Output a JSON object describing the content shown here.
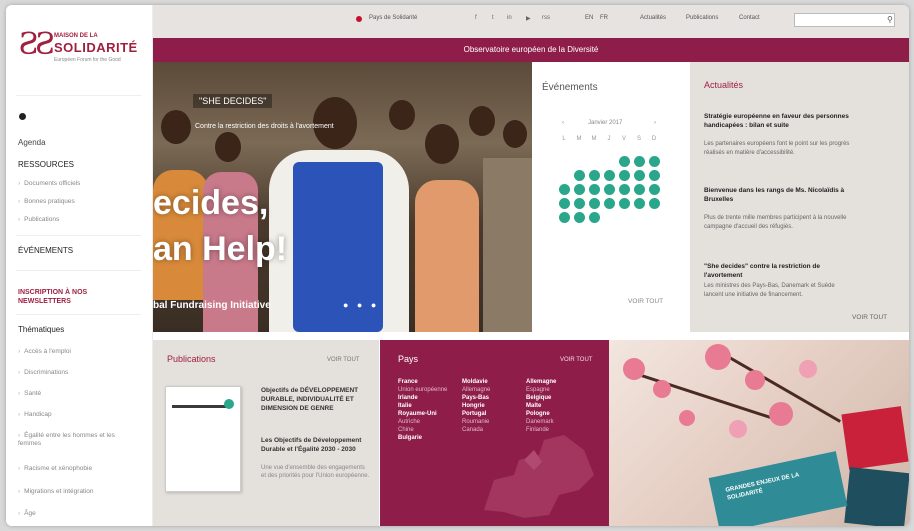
{
  "brand": {
    "mark": "ƧƧ",
    "line1": "MAISON DE LA",
    "line2": "SOLIDARITÉ",
    "line3": "Européen Forum for the Good"
  },
  "topbar": {
    "country_link": "Pays de Solidarité",
    "social": [
      "f",
      "t",
      "in",
      "▶",
      "rss"
    ],
    "langs": [
      "EN",
      "FR"
    ],
    "links": [
      "Actualités",
      "Publications",
      "Contact"
    ],
    "search_placeholder": ""
  },
  "banner": {
    "title": "Observatoire européen de la Diversité"
  },
  "sidebar": {
    "home": "⌂",
    "agenda": "Agenda",
    "resources": "RESSOURCES",
    "resource_items": [
      "Documents officiels",
      "Bonnes pratiques",
      "Publications"
    ],
    "events": "ÉVÉNEMENTS",
    "newsletter": "INSCRIPTION À NOS NEWSLETTERS",
    "themes": "Thématiques",
    "theme_items": [
      "Accès à l'emploi",
      "Discriminations",
      "Santé",
      "Handicap",
      "Égalité entre les hommes et les femmes",
      "Racisme et xénophobie",
      "Migrations et intégration",
      "Âge"
    ]
  },
  "hero": {
    "tag": "\"SHE DECIDES\"",
    "subtitle": "Contre la restriction des droits à l'avortement",
    "line1": "ecides,",
    "line2": "an Help!",
    "caption": "bal Fundraising Initiative",
    "dots": "● ● ●"
  },
  "events": {
    "title": "Événements",
    "month": "Janvier 2017",
    "prev": "‹",
    "next": "›",
    "dow": [
      "L",
      "M",
      "M",
      "J",
      "V",
      "S",
      "D"
    ],
    "more": "VOIR TOUT"
  },
  "news": {
    "title": "Actualités",
    "items": [
      {
        "headline": "Stratégie européenne en faveur des personnes handicapées : bilan et suite",
        "text": "Les partenaires européens font le point sur les progrès réalisés en matière d'accessibilité."
      },
      {
        "headline": "Bienvenue dans les rangs de Ms. Nicolaïdis à Bruxelles",
        "text": "Plus de trente mille membres participent à la nouvelle campagne d'accueil des réfugiés."
      },
      {
        "headline": "\"She decides\" contre la restriction de l'avortement",
        "text": "Les ministres des Pays-Bas, Danemark et Suède lancent une initiative de financement."
      }
    ],
    "more": "VOIR TOUT"
  },
  "publications": {
    "title": "Publications",
    "more": "VOIR TOUT",
    "items": [
      {
        "title": "Objectifs de DÉVELOPPEMENT DURABLE, INDIVIDUALITÉ ET DIMENSION DE GENRE",
        "text": ""
      },
      {
        "title": "Les Objectifs de Développement Durable et l'Égalité 2030 - 2030",
        "text": "Une vue d'ensemble des engagements et des priorités pour l'Union européenne."
      }
    ]
  },
  "pays": {
    "title": "Pays",
    "more": "VOIR TOUT",
    "col1": [
      "France",
      "Union européenne",
      "Irlande",
      "Italie",
      "Royaume-Uni",
      "Autriche",
      "Chine",
      "Bulgarie"
    ],
    "col2": [
      "Moldavie",
      "Allemagne",
      "Pays-Bas",
      "Hongrie",
      "Portugal",
      "Roumanie",
      "Canada"
    ],
    "col3": [
      "Allemagne",
      "Espagne",
      "Belgique",
      "Malte",
      "Pologne",
      "Danemark",
      "Finlande"
    ]
  },
  "flowers": {
    "book_label": "GRANDES ENJEUX DE LA SOLIDARITÉ"
  },
  "colors": {
    "brand": "#8f1d4a",
    "accent_green": "#2aa78a",
    "logo_red": "#a0203f"
  }
}
